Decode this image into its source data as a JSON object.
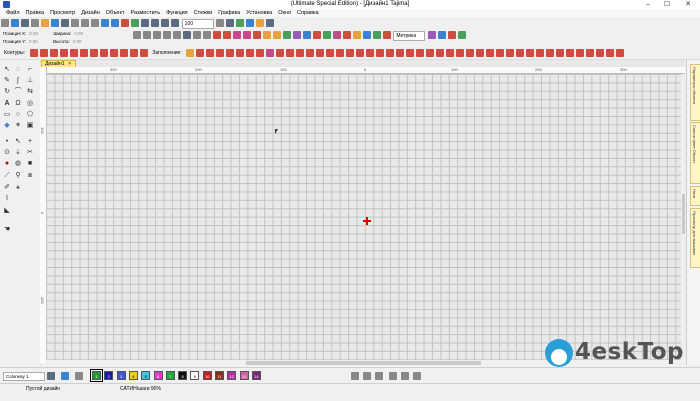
{
  "window": {
    "title": "(Ultimate Special Edition) - [Дизайн1     Tajima]",
    "buttons": [
      "–",
      "☐",
      "✕"
    ]
  },
  "menu": [
    "Файл",
    "Правка",
    "Просмотр",
    "Дизайн",
    "Объект",
    "Разместить",
    "Функция",
    "Стежки",
    "Графика",
    "Установка",
    "Окно",
    "Справка"
  ],
  "toolbar": {
    "zoom_value": "100",
    "units_value": "Метрика",
    "contours_label": "Контуры:",
    "fill_label": "Заполнение:",
    "position_x_label": "Позиция Х:",
    "position_y_label": "Позиция Y:",
    "width_label": "Ширина:",
    "height_label": "Высота:",
    "position_x_value": "0.00",
    "position_y_value": "0.00",
    "width_value": "0.00",
    "height_value": "0.00"
  },
  "document": {
    "tab_label": "Дизайн1",
    "close_glyph": "✕"
  },
  "rulers": {
    "horizontal_ticks": [
      "300",
      "200",
      "100",
      "0",
      "100",
      "200",
      "300"
    ],
    "vertical_ticks": [
      "100",
      "0",
      "100"
    ]
  },
  "right_tabs": [
    "Параметры объекта",
    "Список Цвет Объект",
    "Нити",
    "Просмотр для вышивки"
  ],
  "colorway": {
    "selected": "Colorway 1",
    "swatches": [
      {
        "label": "1",
        "color": "#1f9a3a"
      },
      {
        "label": "2",
        "color": "#1a1aa8"
      },
      {
        "label": "3",
        "color": "#3b55d6"
      },
      {
        "label": "4",
        "color": "#e6d21a"
      },
      {
        "label": "5",
        "color": "#39c7e0"
      },
      {
        "label": "6",
        "color": "#e23ac4"
      },
      {
        "label": "7",
        "color": "#1faa3a"
      },
      {
        "label": "8",
        "color": "#111111"
      },
      {
        "label": "9",
        "color": "#ffffff"
      },
      {
        "label": "10",
        "color": "#c32020"
      },
      {
        "label": "11",
        "color": "#8a2a1a"
      },
      {
        "label": "12",
        "color": "#b02da6"
      },
      {
        "label": "13",
        "color": "#d85ba8"
      },
      {
        "label": "14",
        "color": "#7a2a7a"
      }
    ]
  },
  "status": {
    "left": "Пустой дизайн",
    "middle": "САТИН/шаги 90%"
  },
  "watermark": "4eskTop"
}
